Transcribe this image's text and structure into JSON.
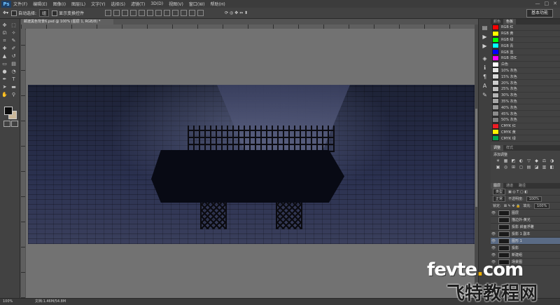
{
  "app": {
    "logo": "Ps"
  },
  "menubar": {
    "items": [
      "文件(F)",
      "编辑(E)",
      "图像(I)",
      "图层(L)",
      "文字(Y)",
      "选择(S)",
      "滤镜(T)",
      "3D(D)",
      "视图(V)",
      "窗口(W)",
      "帮助(H)"
    ],
    "window_controls": [
      "—",
      "□",
      "✕"
    ]
  },
  "options_bar": {
    "auto_select_label": "自动选择:",
    "auto_select_value": "组",
    "show_transform_label": "显示变换控件"
  },
  "workspace": {
    "label": "基本功能"
  },
  "document": {
    "tab_title": "邮渡黑色背景6.psd @ 100% (图层 1, RGB/8) *",
    "zoom": "100%",
    "doc_info": "文档:1.46M/54.8M"
  },
  "swatches_panel": {
    "tabs": [
      "颜色",
      "色板"
    ],
    "active_tab": "色板",
    "items": [
      {
        "name": "RGB 红",
        "color": "#ff0000"
      },
      {
        "name": "RGB 黄",
        "color": "#ffff00"
      },
      {
        "name": "RGB 绿",
        "color": "#00ff00"
      },
      {
        "name": "RGB 青",
        "color": "#00ffff"
      },
      {
        "name": "RGB 蓝",
        "color": "#0000ff"
      },
      {
        "name": "RGB 洋红",
        "color": "#ff00ff"
      },
      {
        "name": "白色",
        "color": "#ffffff"
      },
      {
        "name": "10% 灰色",
        "color": "#e6e6e6"
      },
      {
        "name": "15% 灰色",
        "color": "#d9d9d9"
      },
      {
        "name": "20% 灰色",
        "color": "#cccccc"
      },
      {
        "name": "25% 灰色",
        "color": "#bfbfbf"
      },
      {
        "name": "30% 灰色",
        "color": "#b3b3b3"
      },
      {
        "name": "35% 灰色",
        "color": "#a6a6a6"
      },
      {
        "name": "40% 灰色",
        "color": "#999999"
      },
      {
        "name": "45% 灰色",
        "color": "#8c8c8c"
      },
      {
        "name": "50% 灰色",
        "color": "#808080"
      },
      {
        "name": "CMYK 红",
        "color": "#ed1c24"
      },
      {
        "name": "CMYK 黄",
        "color": "#fff200"
      },
      {
        "name": "CMYK 绿",
        "color": "#00a651"
      }
    ]
  },
  "adjustments_panel": {
    "tabs": [
      "调整",
      "样式"
    ],
    "active_tab": "调整",
    "heading": "添加调整",
    "icons": [
      "☀",
      "▦",
      "◩",
      "◐",
      "▽",
      "◆",
      "⚖",
      "◑",
      "▣",
      "◎",
      "⊞",
      "◻",
      "▤",
      "◪",
      "▥",
      "◧"
    ]
  },
  "layers_panel": {
    "tabs": [
      "图层",
      "通道",
      "路径"
    ],
    "active_tab": "图层",
    "filter_label": "类型",
    "blend_mode": "正常",
    "opacity_label": "不透明度:",
    "opacity_value": "100%",
    "lock_label": "锁定:",
    "fill_label": "填充:",
    "fill_value": "100%",
    "layers": [
      {
        "name": "图层",
        "selected": false,
        "eye": "👁"
      },
      {
        "name": "描边外-黄光",
        "selected": false,
        "eye": ""
      },
      {
        "name": "投影 斜面浮雕",
        "selected": false,
        "eye": ""
      },
      {
        "name": "投影 1 副本",
        "selected": false,
        "eye": "👁"
      },
      {
        "name": "图形 1",
        "selected": true,
        "eye": "👁"
      },
      {
        "name": "投影",
        "selected": false,
        "eye": "👁"
      },
      {
        "name": "新建组",
        "selected": false,
        "eye": "👁"
      },
      {
        "name": "场景图",
        "selected": false,
        "eye": "👁"
      }
    ]
  },
  "watermark": {
    "line1_prefix": "fevte",
    "line1_dot": ".",
    "line1_suffix": "com",
    "line2": "飞特教程网"
  }
}
